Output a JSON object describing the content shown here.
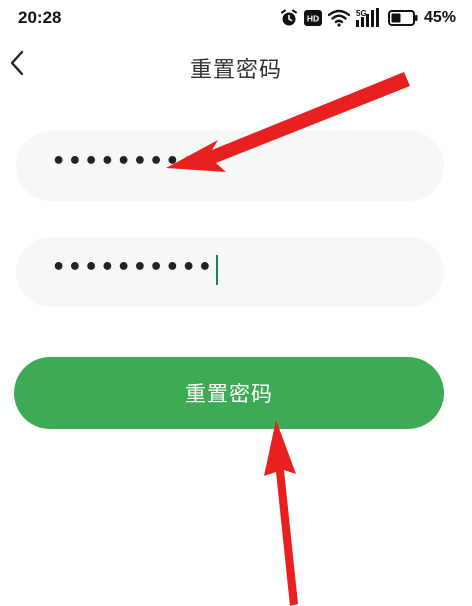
{
  "status_bar": {
    "time": "20:28",
    "battery_percent": "45%",
    "network_label": "5G",
    "hd_label": "HD",
    "icons": [
      "alarm-icon",
      "hd-icon",
      "wifi-icon",
      "signal-5g-icon",
      "battery-icon"
    ],
    "battery_level": 0.45
  },
  "header": {
    "title": "重置密码",
    "back_icon": "chevron-left-icon"
  },
  "form": {
    "new_password_value": "•••••••••",
    "confirm_password_value": "••••••••••"
  },
  "actions": {
    "reset_label": "重置密码"
  },
  "colors": {
    "primary_button": "#3daa55",
    "input_background": "#f6f8f8",
    "caret": "#1a7f6a",
    "annotation_arrow": "#e8201f"
  }
}
